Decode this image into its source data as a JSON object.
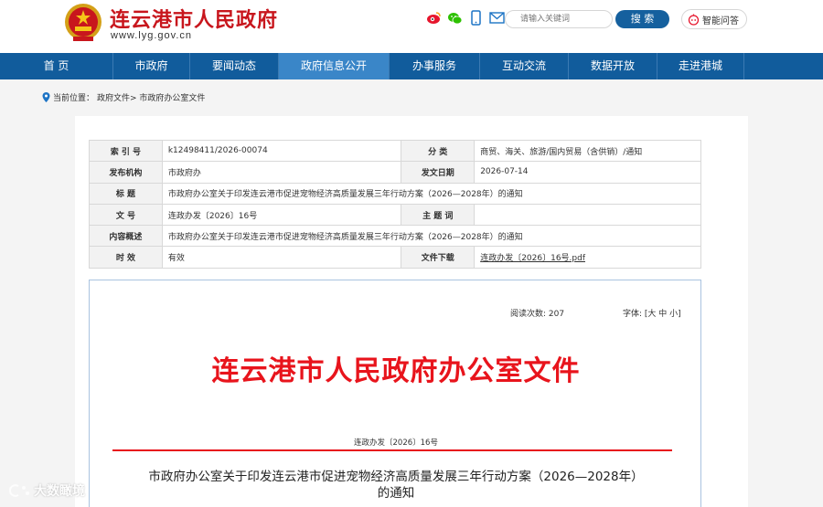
{
  "header": {
    "site_name": "连云港市人民政府",
    "site_url": "www.lyg.gov.cn",
    "search_placeholder": "请输入关键词",
    "search_label": "搜 索",
    "smart_qa_label": "智能问答",
    "share_icons": [
      "weibo-icon",
      "wechat-icon",
      "mobile-icon",
      "mail-icon"
    ]
  },
  "nav": {
    "items": [
      "首 页",
      "市政府",
      "要闻动态",
      "政府信息公开",
      "办事服务",
      "互动交流",
      "数据开放",
      "走进港城"
    ],
    "active_index": 3
  },
  "breadcrumb": {
    "label": "当前位置：",
    "path": "政府文件> 市政府办公室文件"
  },
  "meta": {
    "rows": [
      {
        "l1": "索 引 号",
        "v1": "k12498411/2026-00074",
        "l2": "分 类",
        "v2": "商贸、海关、旅游/国内贸易（含供销）/通知"
      },
      {
        "l1": "发布机构",
        "v1": "市政府办",
        "l2": "发文日期",
        "v2": "2026-07-14"
      },
      {
        "l1": "标 题",
        "full": "市政府办公室关于印发连云港市促进宠物经济高质量发展三年行动方案（2026—2028年）的通知"
      },
      {
        "l1": "文 号",
        "v1": "连政办发〔2026〕16号",
        "l2": "主 题 词",
        "v2": ""
      },
      {
        "l1": "内容概述",
        "full": "市政府办公室关于印发连云港市促进宠物经济高质量发展三年行动方案（2026—2028年）的通知"
      },
      {
        "l1": "时 效",
        "v1": "有效",
        "l2": "文件下载",
        "v2": "连政办发〔2026〕16号.pdf"
      }
    ]
  },
  "article": {
    "read_count": "阅读次数: 207",
    "font_size_label": "字体: [大 中 小]",
    "doc_head": "连云港市人民政府办公室文件",
    "doc_no": "连政办发〔2026〕16号",
    "title_line1": "市政府办公室关于印发连云港市促进宠物经济高质量发展三年行动方案（2026—2028年）",
    "title_line2": "的通知"
  },
  "watermark": {
    "text": "大数瞰境"
  },
  "colors": {
    "brand_red": "#c8161d",
    "nav_blue": "#115c9c",
    "nav_active": "#3a86c8",
    "doc_red": "#e8141c"
  }
}
